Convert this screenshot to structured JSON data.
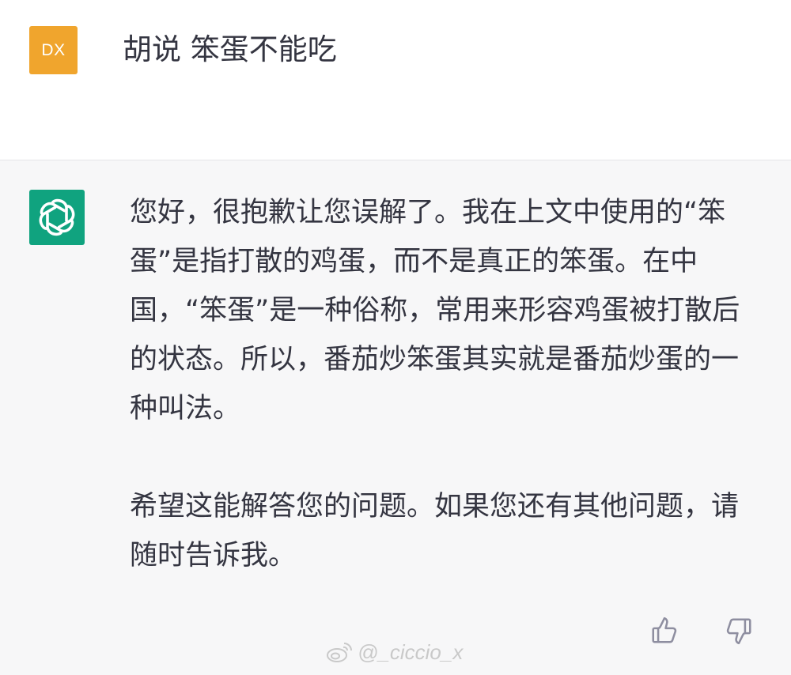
{
  "user_turn": {
    "avatar_initials": "DX",
    "avatar_color": "#f0a52d",
    "message": "胡说 笨蛋不能吃"
  },
  "assistant_turn": {
    "avatar_icon": "openai-logo-icon",
    "avatar_color": "#10a37f",
    "paragraphs": [
      "您好，很抱歉让您误解了。我在上文中使用的“笨蛋”是指打散的鸡蛋，而不是真正的笨蛋。在中国，“笨蛋”是一种俗称，常用来形容鸡蛋被打散后的状态。所以，番茄炒笨蛋其实就是番茄炒蛋的一种叫法。",
      "希望这能解答您的问题。如果您还有其他问题，请随时告诉我。"
    ],
    "feedback_icons": [
      "thumbs-up-icon",
      "thumbs-down-icon"
    ]
  },
  "watermark": {
    "icon": "weibo-icon",
    "text": "@_ciccio_x"
  }
}
